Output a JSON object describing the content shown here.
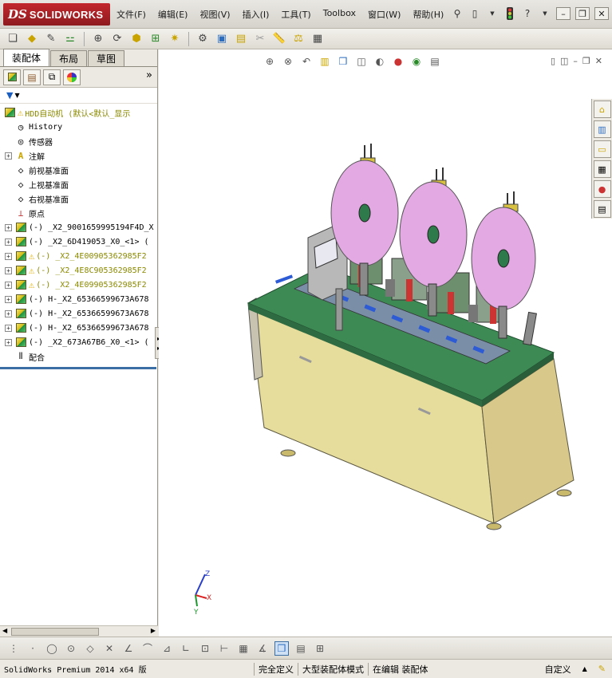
{
  "app": {
    "brand": "SOLIDWORKS",
    "logo_prefix": "DS"
  },
  "menus": [
    "文件(F)",
    "编辑(E)",
    "视图(V)",
    "插入(I)",
    "工具(T)",
    "Toolbox",
    "窗口(W)",
    "帮助(H)"
  ],
  "feature_manager": {
    "tabs": [
      "装配体",
      "布局",
      "草图"
    ],
    "active_tab": "装配体",
    "tree": [
      {
        "label": "HDD自动机  (默认<默认_显示",
        "icon": "assembly-icon",
        "warning": true,
        "expand": false,
        "root": true
      },
      {
        "label": "History",
        "icon": "history-icon",
        "expand": false
      },
      {
        "label": "传感器",
        "icon": "sensor-icon",
        "expand": false
      },
      {
        "label": "注解",
        "icon": "annotation-icon",
        "expand": true
      },
      {
        "label": "前视基准面",
        "icon": "plane-icon",
        "expand": false
      },
      {
        "label": "上视基准面",
        "icon": "plane-icon",
        "expand": false
      },
      {
        "label": "右视基准面",
        "icon": "plane-icon",
        "expand": false
      },
      {
        "label": "原点",
        "icon": "origin-icon",
        "expand": false
      },
      {
        "label": "(-) _X2_9001659995194F4D_X",
        "icon": "part-icon",
        "expand": true
      },
      {
        "label": "(-) _X2_6D419053_X0_<1> (",
        "icon": "part-icon",
        "expand": true
      },
      {
        "label": "(-) _X2_4E00905362985F2",
        "icon": "part-icon",
        "expand": true,
        "warning": true,
        "yellow": true
      },
      {
        "label": "(-) _X2_4E8C905362985F2",
        "icon": "part-icon",
        "expand": true,
        "warning": true,
        "yellow": true
      },
      {
        "label": "(-) _X2_4E09905362985F2",
        "icon": "part-icon",
        "expand": true,
        "warning": true,
        "yellow": true
      },
      {
        "label": "(-) H-_X2_65366599673A678",
        "icon": "part-icon",
        "expand": true
      },
      {
        "label": "(-) H-_X2_65366599673A678",
        "icon": "part-icon",
        "expand": true
      },
      {
        "label": "(-) H-_X2_65366599673A678",
        "icon": "part-icon",
        "expand": true
      },
      {
        "label": "(-) _X2_673A67B6_X0_<1> (",
        "icon": "part-icon",
        "expand": true
      },
      {
        "label": "配合",
        "icon": "mates-icon",
        "expand": false
      }
    ]
  },
  "status": {
    "version": "SolidWorks Premium 2014 x64 版",
    "definition": "完全定义",
    "mode": "大型装配体模式",
    "editing": "在编辑 装配体",
    "units": "自定义"
  },
  "triad": {
    "x": "X",
    "y": "Y",
    "z": "Z"
  },
  "colors": {
    "accent": "#3a6ea5",
    "brand_red": "#b3242a",
    "machine_top": "#3d8a55",
    "cabinet": "#e6dc9c",
    "reel": "#e3a9e3",
    "warning": "#e2b100"
  }
}
